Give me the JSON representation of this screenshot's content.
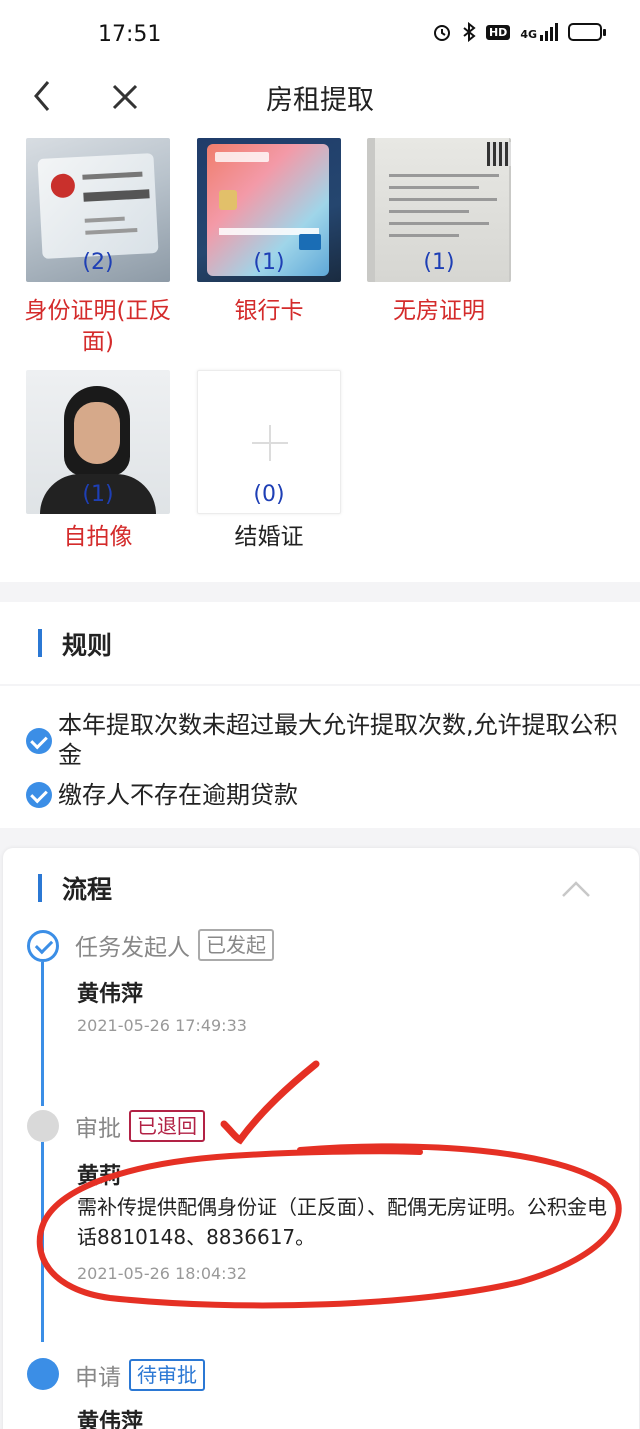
{
  "status_bar": {
    "time": "17:51",
    "icons": [
      "alarm-icon",
      "bluetooth-icon",
      "hd-icon",
      "signal-4g-icon",
      "battery-icon"
    ],
    "hd_label": "HD",
    "network_label": "4G"
  },
  "nav": {
    "title": "房租提取",
    "back_icon": "chevron-left-icon",
    "close_icon": "close-icon"
  },
  "attachments": [
    {
      "label": "身份证明(正反面)",
      "count": "(2)",
      "required": true
    },
    {
      "label": "银行卡",
      "count": "(1)",
      "required": true
    },
    {
      "label": "无房证明",
      "count": "(1)",
      "required": true
    },
    {
      "label": "自拍像",
      "count": "(1)",
      "required": true
    },
    {
      "label": "结婚证",
      "count": "(0)",
      "required": false
    }
  ],
  "rules": {
    "title": "规则",
    "items": [
      "本年提取次数未超过最大允许提取次数,允许提取公积金",
      "缴存人不存在逾期贷款"
    ]
  },
  "process": {
    "title": "流程",
    "steps": [
      {
        "title": "任务发起人",
        "status": "已发起",
        "person": "黄伟萍",
        "time": "2021-05-26 17:49:33"
      },
      {
        "title": "审批",
        "status": "已退回",
        "person": "黄莉",
        "comment": "需补传提供配偶身份证（正反面）、配偶无房证明。公积金电话8810148、8836617。",
        "time": "2021-05-26 18:04:32"
      },
      {
        "title": "申请",
        "status": "待审批",
        "person": "黄伟萍"
      }
    ]
  },
  "colors": {
    "accent": "#3b8ee6",
    "required_label": "#d42b2b",
    "count": "#1e3fb5",
    "returned": "#b22245",
    "annotation_ink": "#e53024"
  }
}
